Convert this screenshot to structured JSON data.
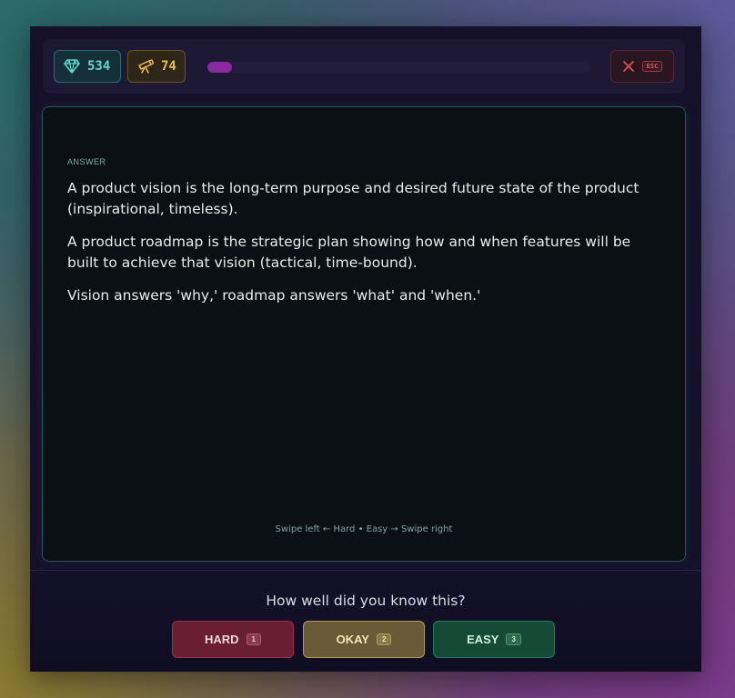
{
  "topbar": {
    "gems": "534",
    "telescope": "74",
    "progress": 0.065,
    "esc_label": "ESC"
  },
  "card": {
    "label": "ANSWER",
    "paragraphs": [
      "A product vision is the long-term purpose and desired future state of the product (inspirational, timeless).",
      "A product roadmap is the strategic plan showing how and when features will be built to achieve that vision (tactical, time-bound).",
      "Vision answers 'why,' roadmap answers 'what' and 'when.'"
    ],
    "swipe_hint": "Swipe left ← Hard • Easy → Swipe right"
  },
  "rating": {
    "question": "How well did you know this?",
    "buttons": [
      {
        "label": "HARD",
        "key": "1"
      },
      {
        "label": "OKAY",
        "key": "2"
      },
      {
        "label": "EASY",
        "key": "3"
      }
    ]
  },
  "colors": {
    "accent_teal": "#5fd6d0",
    "accent_gold": "#f0c040",
    "progress": "#8a2aa0",
    "danger": "#e05050"
  },
  "icons": {
    "gems": "gem-icon",
    "telescope": "telescope-icon",
    "close": "close-icon"
  }
}
